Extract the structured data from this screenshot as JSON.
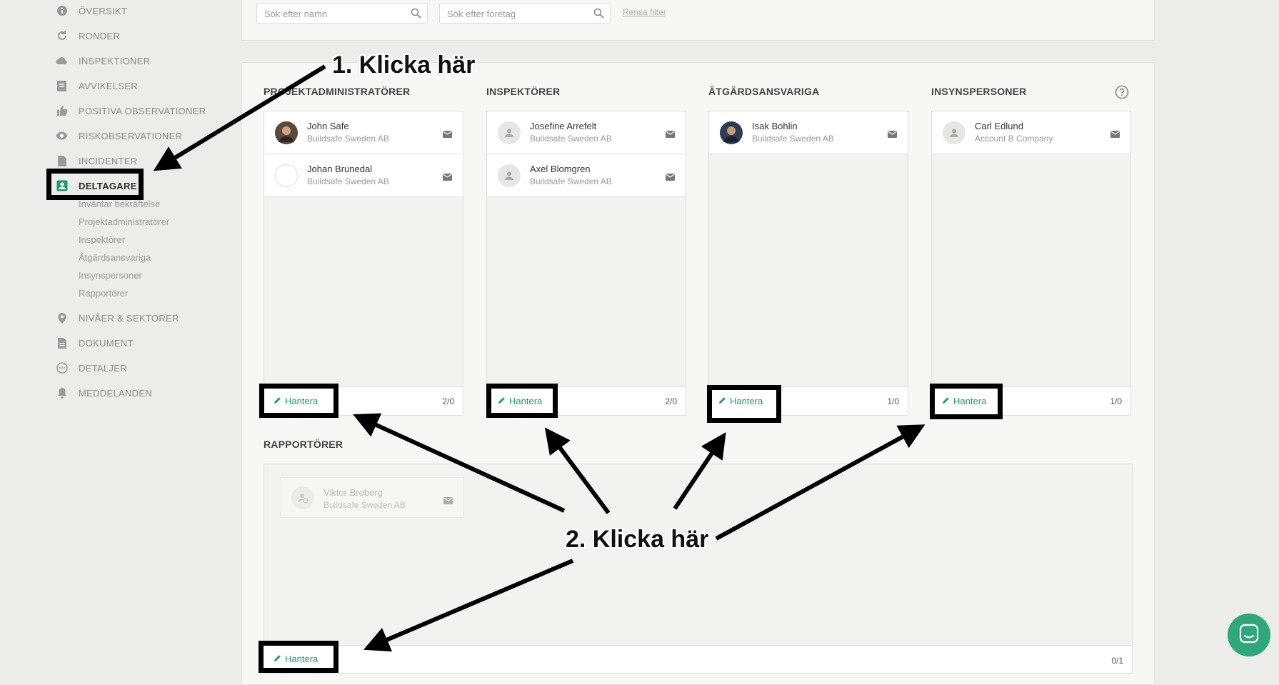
{
  "sidebar": {
    "items": [
      {
        "label": "ÖVERSIKT",
        "icon": "info-icon"
      },
      {
        "label": "RONDER",
        "icon": "refresh-icon"
      },
      {
        "label": "INSPEKTIONER",
        "icon": "cloud-icon"
      },
      {
        "label": "AVVIKELSER",
        "icon": "report-icon"
      },
      {
        "label": "POSITIVA OBSERVATIONER",
        "icon": "thumbs-up-icon"
      },
      {
        "label": "RISKOBSERVATIONER",
        "icon": "eye-icon"
      },
      {
        "label": "INCIDENTER",
        "icon": "document-icon"
      },
      {
        "label": "DELTAGARE",
        "icon": "contact-card-icon"
      },
      {
        "label": "NIVÅER & SEKTORER",
        "icon": "location-pin-icon"
      },
      {
        "label": "DOKUMENT",
        "icon": "file-icon"
      },
      {
        "label": "DETALJER",
        "icon": "more-icon"
      },
      {
        "label": "MEDDELANDEN",
        "icon": "bell-icon"
      }
    ],
    "active": "DELTAGARE",
    "subitems": [
      "Inväntar bekräftelse",
      "Projektadministratörer",
      "Inspektörer",
      "Åtgärdsansvariga",
      "Insynspersoner",
      "Rapportörer"
    ]
  },
  "filters": {
    "name_placeholder": "Sök efter namn",
    "company_placeholder": "Sök efter företag",
    "clear_label": "Rensa filter"
  },
  "columns": [
    {
      "title": "PROJEKTADMINISTRATÖRER",
      "people": [
        {
          "name": "John Safe",
          "company": "Buildsafe Sweden AB"
        },
        {
          "name": "Johan Brunedal",
          "company": "Buildsafe Sweden AB"
        }
      ],
      "manage_label": "Hantera",
      "count": "2/0"
    },
    {
      "title": "INSPEKTÖRER",
      "people": [
        {
          "name": "Josefine Arrefelt",
          "company": "Buildsafe Sweden AB"
        },
        {
          "name": "Axel Blomgren",
          "company": "Buildsafe Sweden AB"
        }
      ],
      "manage_label": "Hantera",
      "count": "2/0"
    },
    {
      "title": "ÅTGÄRDSANSVARIGA",
      "people": [
        {
          "name": "Isak Bohlin",
          "company": "Buildsafe Sweden AB"
        }
      ],
      "manage_label": "Hantera",
      "count": "1/0"
    },
    {
      "title": "INSYNSPERSONER",
      "people": [
        {
          "name": "Carl Edlund",
          "company": "Account B Company"
        }
      ],
      "manage_label": "Hantera",
      "count": "1/0"
    }
  ],
  "reporters": {
    "title": "RAPPORTÖRER",
    "people": [
      {
        "name": "Viktor Broberg",
        "company": "Buildsafe Sweden AB"
      }
    ],
    "manage_label": "Hantera",
    "count": "0/1"
  },
  "annotations": {
    "step1": "1. Klicka här",
    "step2": "2. Klicka här"
  },
  "colors": {
    "accent": "#1d9a6c",
    "chat": "#2ea87a"
  }
}
